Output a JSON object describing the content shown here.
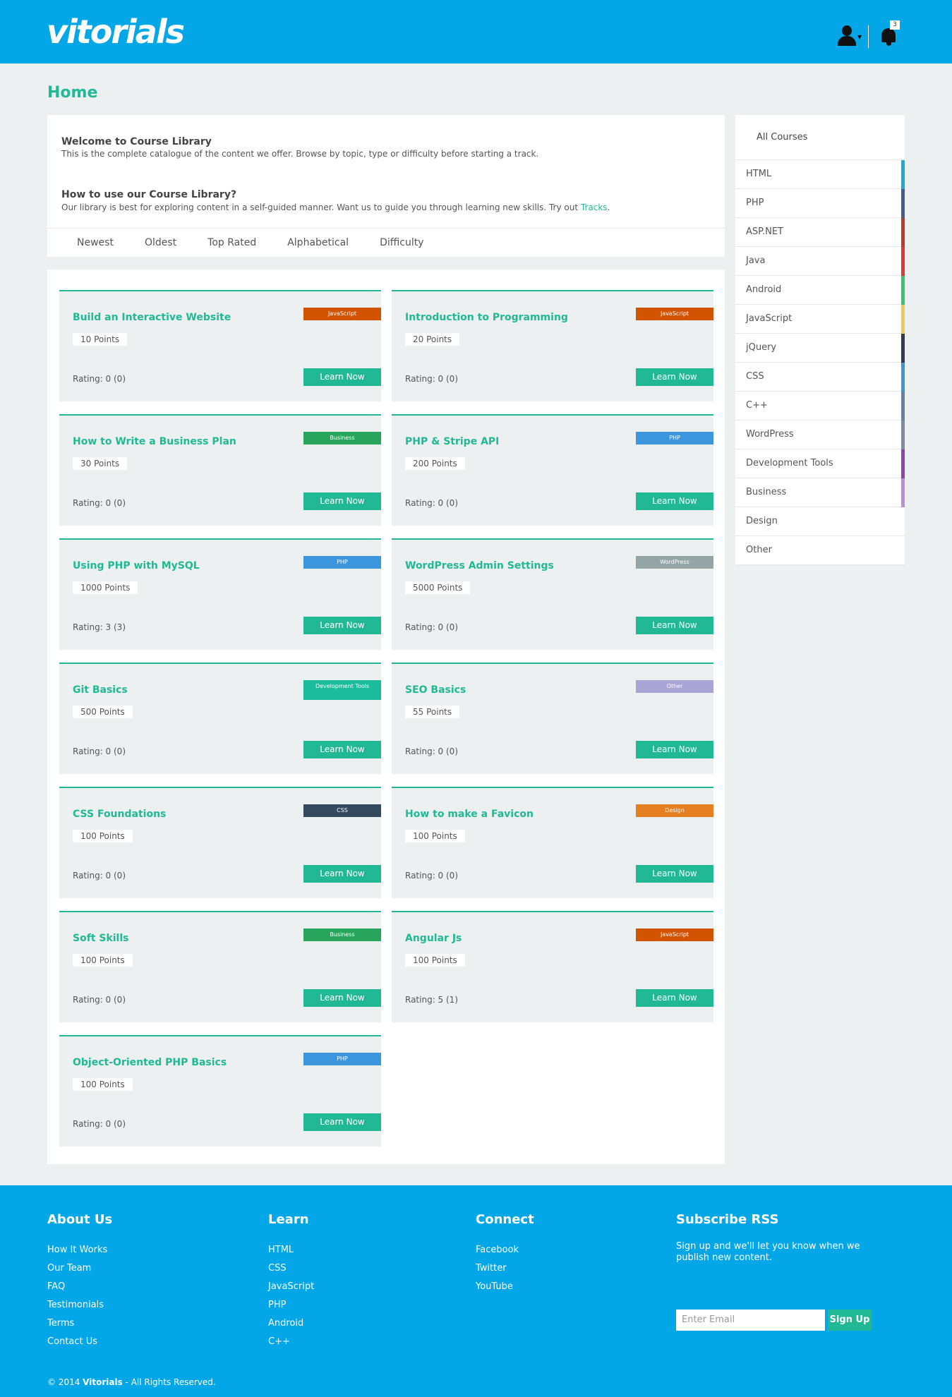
{
  "header": {
    "logo": "vitorials",
    "notification_count": "3"
  },
  "page_title": "Home",
  "intro": {
    "welcome_title": "Welcome to Course Library",
    "welcome_text": "This is the complete catalogue of the content we offer. Browse by topic, type or difficulty before starting a track.",
    "howto_title": "How to use our Course Library?",
    "howto_text": "Our library is best for exploring content in a self-guided manner. Want us to guide you through learning new skills. Try out ",
    "howto_link": "Tracks",
    "howto_end": "."
  },
  "sort_tabs": [
    "Newest",
    "Oldest",
    "Top Rated",
    "Alphabetical",
    "Difficulty"
  ],
  "courses": [
    {
      "title": "Build an Interactive Website",
      "points": "10 Points",
      "rating": "Rating: 0 (0)",
      "tag": "JavaScript",
      "tag_color": "#d35400"
    },
    {
      "title": "Introduction to Programming",
      "points": "20 Points",
      "rating": "Rating: 0 (0)",
      "tag": "JavaScript",
      "tag_color": "#d35400"
    },
    {
      "title": "How to Write a Business Plan",
      "points": "30 Points",
      "rating": "Rating: 0 (0)",
      "tag": "Business",
      "tag_color": "#27a55c"
    },
    {
      "title": "PHP & Stripe API",
      "points": "200 Points",
      "rating": "Rating: 0 (0)",
      "tag": "PHP",
      "tag_color": "#3b96dd"
    },
    {
      "title": "Using PHP with MySQL",
      "points": "1000 Points",
      "rating": "Rating: 3 (3)",
      "tag": "PHP",
      "tag_color": "#3b96dd"
    },
    {
      "title": "WordPress Admin Settings",
      "points": "5000 Points",
      "rating": "Rating: 0 (0)",
      "tag": "WordPress",
      "tag_color": "#95a5a6"
    },
    {
      "title": "Git Basics",
      "points": "500 Points",
      "rating": "Rating: 0 (0)",
      "tag": "Development Tools",
      "tag_color": "#1abc9c"
    },
    {
      "title": "SEO Basics",
      "points": "55 Points",
      "rating": "Rating: 0 (0)",
      "tag": "Other",
      "tag_color": "#a9a4d4"
    },
    {
      "title": "CSS Foundations",
      "points": "100 Points",
      "rating": "Rating: 0 (0)",
      "tag": "CSS",
      "tag_color": "#34495e"
    },
    {
      "title": "How to make a Favicon",
      "points": "100 Points",
      "rating": "Rating: 0 (0)",
      "tag": "Design",
      "tag_color": "#e67e22"
    },
    {
      "title": "Soft Skills",
      "points": "100 Points",
      "rating": "Rating: 0 (0)",
      "tag": "Business",
      "tag_color": "#27a55c"
    },
    {
      "title": "Angular Js",
      "points": "100 Points",
      "rating": "Rating: 5 (1)",
      "tag": "JavaScript",
      "tag_color": "#d35400"
    },
    {
      "title": "Object-Oriented PHP Basics",
      "points": "100 Points",
      "rating": "Rating: 0 (0)",
      "tag": "PHP",
      "tag_color": "#3b96dd"
    }
  ],
  "learn_label": "Learn Now",
  "sidebar": {
    "all": "All Courses",
    "items": [
      {
        "label": "HTML",
        "color": "#1ea9e1"
      },
      {
        "label": "PHP",
        "color": "#455c8f"
      },
      {
        "label": "ASP.NET",
        "color": "#c0392b"
      },
      {
        "label": "Java",
        "color": "#e03a2f"
      },
      {
        "label": "Android",
        "color": "#3ac279"
      },
      {
        "label": "JavaScript",
        "color": "#f1c85a"
      },
      {
        "label": "jQuery",
        "color": "#2c3e50"
      },
      {
        "label": "CSS",
        "color": "#3b96dd"
      },
      {
        "label": "C++",
        "color": "#6a7fa6"
      },
      {
        "label": "WordPress",
        "color": "#7f8c9d"
      },
      {
        "label": "Development Tools",
        "color": "#8e44ad"
      },
      {
        "label": "Business",
        "color": "#b990d6"
      },
      {
        "label": "Design",
        "color": ""
      },
      {
        "label": "Other",
        "color": ""
      }
    ]
  },
  "footer": {
    "about": {
      "title": "About Us",
      "links": [
        "How It Works",
        "Our Team",
        "FAQ",
        "Testimonials",
        "Terms",
        "Contact Us"
      ]
    },
    "learn": {
      "title": "Learn",
      "links": [
        "HTML",
        "CSS",
        "JavaScript",
        "PHP",
        "Android",
        "C++"
      ]
    },
    "connect": {
      "title": "Connect",
      "links": [
        "Facebook",
        "Twitter",
        "YouTube"
      ]
    },
    "subscribe": {
      "title": "Subscribe RSS",
      "text": "Sign up and we'll let you know when we publish new content.",
      "placeholder": "Enter Email",
      "button": "Sign Up"
    },
    "copyright_pre": "© 2014 ",
    "copyright_brand": "Vitorials",
    "copyright_post": " - All Rights Reserved."
  }
}
